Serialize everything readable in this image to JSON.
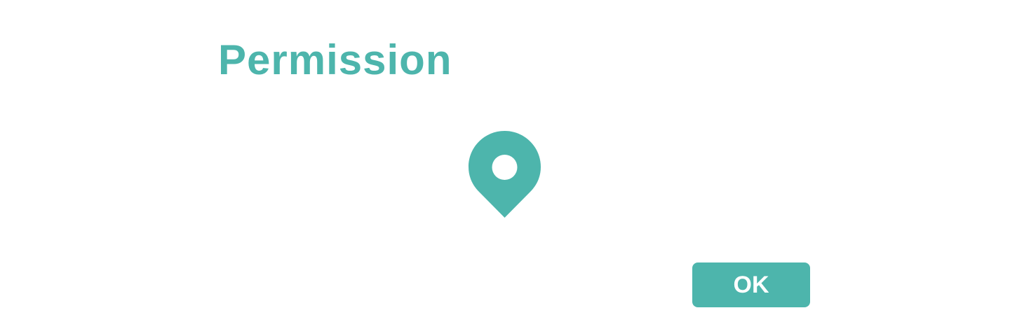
{
  "dialog": {
    "title": "Permission",
    "icon": "location-pin-icon",
    "ok_label": "OK"
  },
  "colors": {
    "accent": "#4db5ac",
    "background": "#ffffff",
    "button_text": "#ffffff"
  }
}
